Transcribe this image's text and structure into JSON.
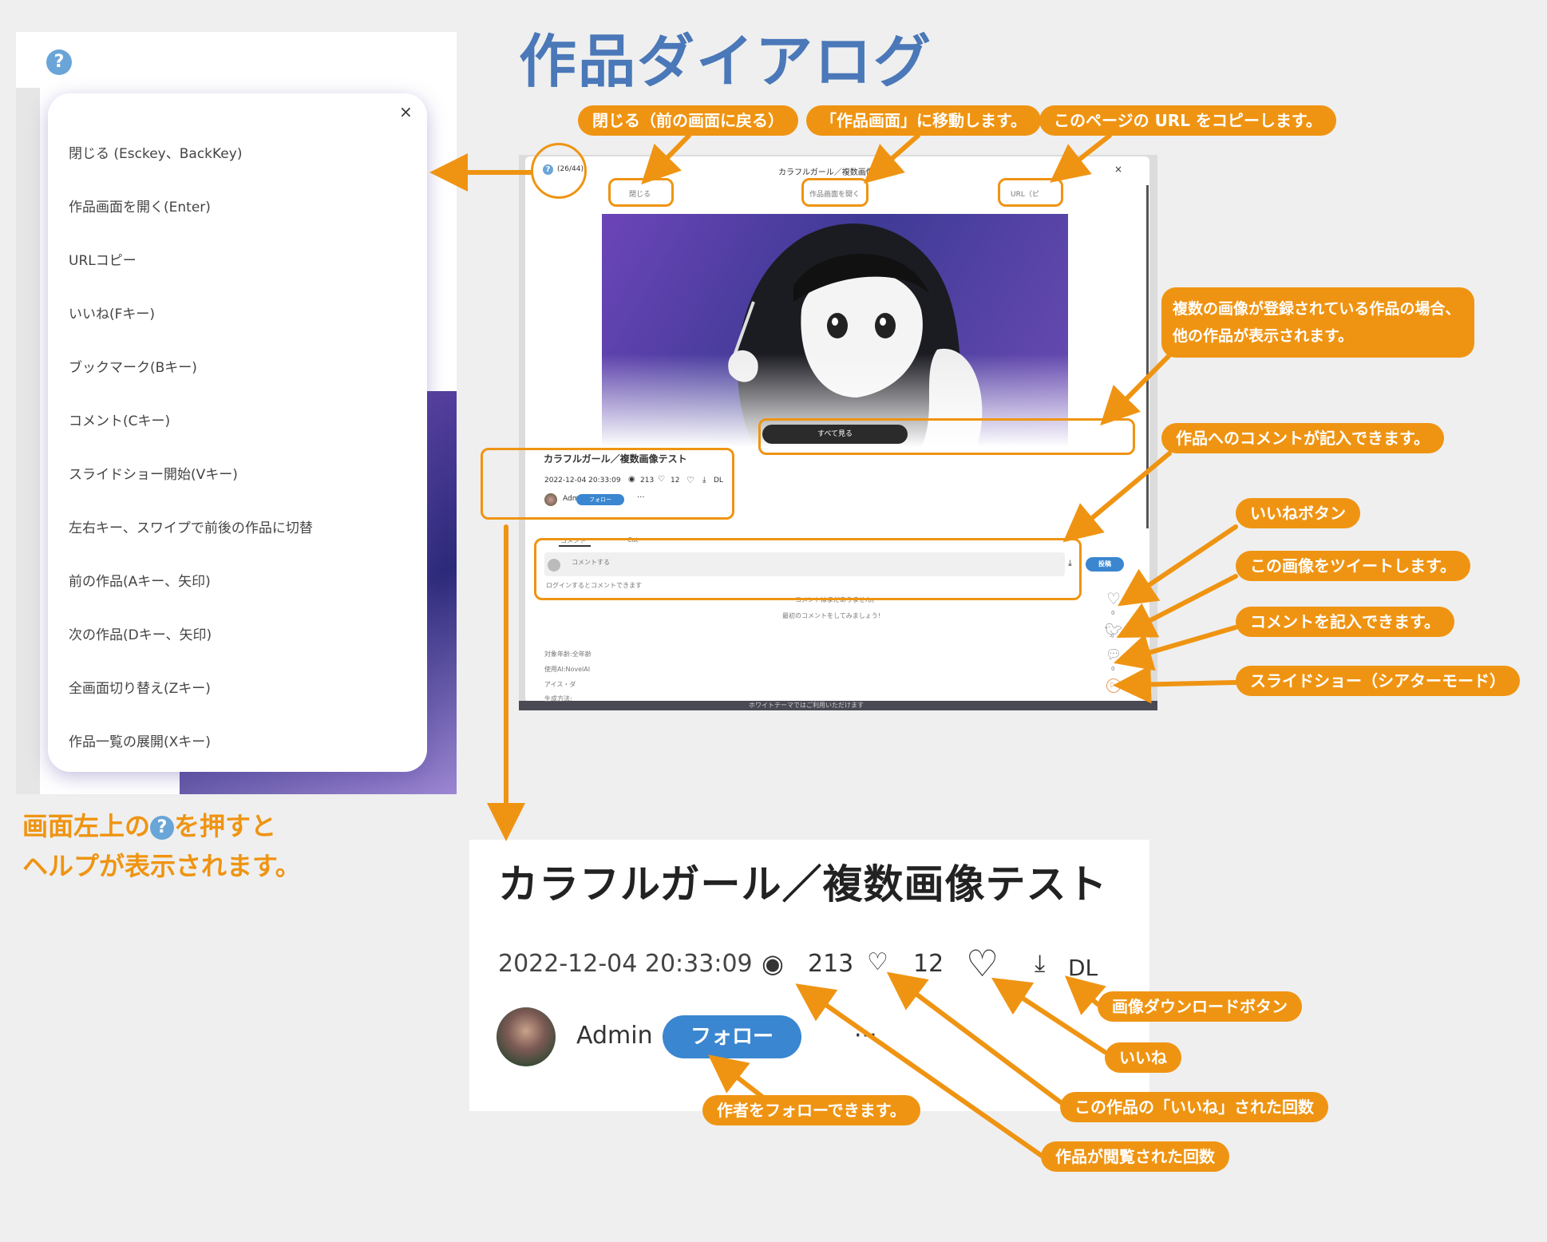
{
  "page_title": "作品ダイアログ",
  "help": {
    "icon": "question-circle-icon",
    "close": "×",
    "items": [
      "閉じる (Esckey、BackKey)",
      "作品画面を開く(Enter)",
      "URLコピー",
      "いいね(Fキー)",
      "ブックマーク(Bキー)",
      "コメント(Cキー)",
      "スライドショー開始(Vキー)",
      "左右キー、スワイプで前後の作品に切替",
      "前の作品(Aキー、矢印)",
      "次の作品(Dキー、矢印)",
      "全画面切り替え(Zキー)",
      "作品一覧の展開(Xキー)"
    ],
    "note_line1_prefix": "画面左上の",
    "note_qmark": "?",
    "note_line1_suffix": "を押すと",
    "note_line2": "ヘルプが表示されます。"
  },
  "dialog": {
    "counter": "(26/44)",
    "title": "カラフルガール／複数画像...",
    "close": "×",
    "btn_close": "閉じる",
    "btn_open": "作品画面を開く",
    "btn_url": "URL（ピ",
    "see_all": "すべて見る",
    "work_title": "カラフルガール／複数画像テスト",
    "date": "2022-12-04 20:33:09",
    "views": "213",
    "likes": "12",
    "dl": "DL",
    "author": "Admin",
    "follow": "フォロー",
    "more": "···",
    "tab1": "コメント",
    "tab2": "Cat",
    "comment_placeholder": "コメントする",
    "post": "投稿",
    "login_note": "ログインするとコメントできます",
    "no_comment1": "コメントはまだありません。",
    "no_comment2": "最初のコメントをしてみましょう!",
    "meta1": "対象年齢:全年齢",
    "meta2": "使用AI:NovelAI",
    "meta3": "アイス・ダ",
    "meta4": "生成方法:",
    "bottom_note": "ホワイトテーマではご利用いただけます",
    "like_count": "0",
    "comment_count": "0"
  },
  "zoom": {
    "title": "カラフルガール／複数画像テスト",
    "date": "2022-12-04 20:33:09",
    "views": "213",
    "likes": "12",
    "dl": "DL",
    "author": "Admin",
    "follow": "フォロー",
    "more": "···"
  },
  "callouts": {
    "close": "閉じる（前の画面に戻る）",
    "open": "「作品画面」に移動します。",
    "url": "このページの URL をコピーします。",
    "multi_line1": "複数の画像が登録されている作品の場合、",
    "multi_line2": "他の作品が表示されます。",
    "comment_area": "作品へのコメントが記入できます。",
    "like_btn": "いいねボタン",
    "tweet": "この画像をツイートします。",
    "comment": "コメントを記入できます。",
    "slideshow": "スライドショー（シアターモード）",
    "download": "画像ダウンロードボタン",
    "like": "いいね",
    "like_count": "この作品の「いいね」された回数",
    "follow": "作者をフォローできます。",
    "views": "作品が閲覧された回数"
  },
  "colors": {
    "accent": "#ef9412",
    "title_blue": "#4a78b8",
    "follow_blue": "#3a86d0"
  }
}
